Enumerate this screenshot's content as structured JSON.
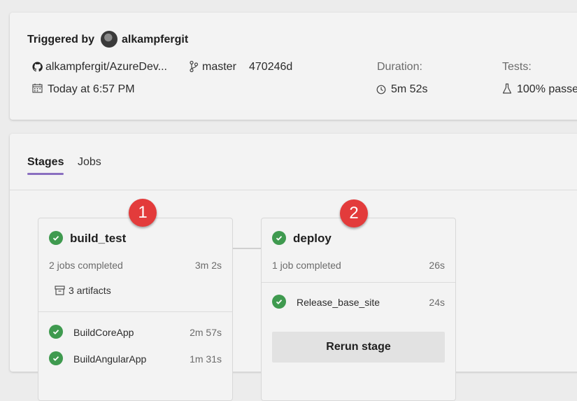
{
  "summary": {
    "triggered_by_label": "Triggered by",
    "user": "alkampfergit",
    "repo": "alkampfergit/AzureDev...",
    "branch": "master",
    "commit": "470246d",
    "date": "Today at 6:57 PM",
    "duration_label": "Duration:",
    "duration": "5m 52s",
    "tests_label": "Tests:",
    "tests": "100% passe"
  },
  "tabs": [
    {
      "label": "Stages",
      "active": true
    },
    {
      "label": "Jobs",
      "active": false
    }
  ],
  "stages": [
    {
      "badge": "1",
      "name": "build_test",
      "summary": "2 jobs completed",
      "duration": "3m 2s",
      "artifacts": "3 artifacts",
      "jobs": [
        {
          "name": "BuildCoreApp",
          "duration": "2m 57s",
          "status": "succeeded"
        },
        {
          "name": "BuildAngularApp",
          "duration": "1m 31s",
          "status": "succeeded"
        }
      ]
    },
    {
      "badge": "2",
      "name": "deploy",
      "summary": "1 job completed",
      "duration": "26s",
      "jobs": [
        {
          "name": "Release_base_site",
          "duration": "24s",
          "status": "succeeded"
        }
      ],
      "rerun_label": "Rerun stage"
    }
  ],
  "colors": {
    "success": "#3f9a4f",
    "badge": "#e33b3b",
    "tab_accent": "#8a6fc0"
  }
}
